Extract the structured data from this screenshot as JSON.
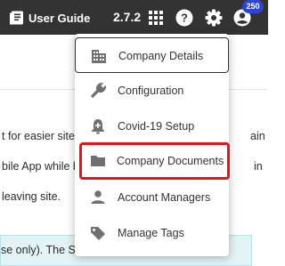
{
  "header": {
    "guide_label": "User Guide",
    "version": "2.7.2",
    "notification_count": "250",
    "icons": [
      "book-icon",
      "grid-apps-icon",
      "help-icon",
      "settings-gear-icon",
      "account-icon"
    ]
  },
  "background": {
    "line1_left": "t for easier site n",
    "line1_right": "ain",
    "line2_left": "bile App while b",
    "line2_right": "in",
    "line3_left": "leaving site.",
    "info_text": "se only). The Site"
  },
  "menu": {
    "items": [
      {
        "label": "Company Details",
        "icon": "company-building-icon",
        "state": "selected"
      },
      {
        "label": "Configuration",
        "icon": "wrench-icon",
        "state": "normal"
      },
      {
        "label": "Covid-19 Setup",
        "icon": "alarm-bell-icon",
        "state": "normal"
      },
      {
        "label": "Company Documents",
        "icon": "folder-icon",
        "state": "highlighted"
      },
      {
        "label": "Account Managers",
        "icon": "person-icon",
        "state": "normal"
      },
      {
        "label": "Manage Tags",
        "icon": "tag-icon",
        "state": "normal"
      }
    ]
  },
  "colors": {
    "topbar": "#333333",
    "badge": "#2d46d6",
    "highlight_outline": "#e0161b",
    "info_banner": "#e3f4f6",
    "icon_gray": "#707070"
  }
}
